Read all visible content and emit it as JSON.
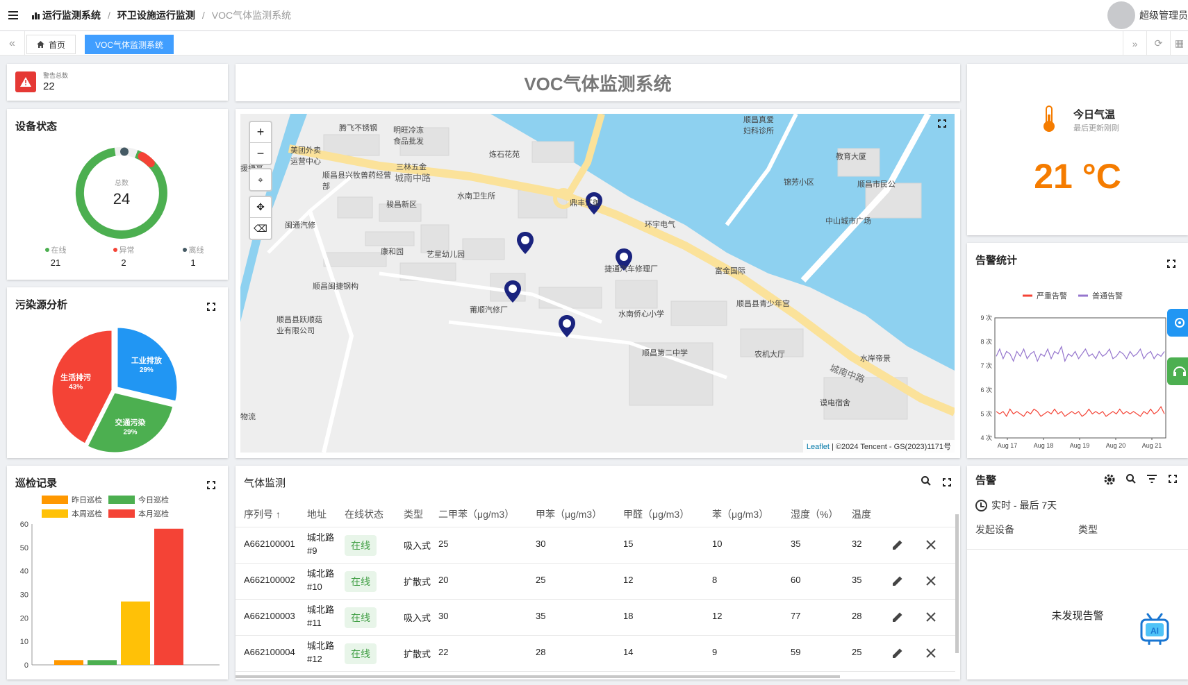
{
  "breadcrumb": {
    "level1": "运行监测系统",
    "level2": "环卫设施运行监测",
    "level3": "VOC气体监测系统"
  },
  "user": {
    "name": "超级管理员"
  },
  "tabs": [
    {
      "label": "首页"
    },
    {
      "label": "VOC气体监测系统"
    }
  ],
  "page_title": "VOC气体监测系统",
  "warning_total": {
    "label": "警告总数",
    "value": "22"
  },
  "device_status": {
    "title": "设备状态",
    "center_label": "总数",
    "total": "24",
    "legend": [
      {
        "label": "在线",
        "value": "21",
        "color": "#4caf50"
      },
      {
        "label": "异常",
        "value": "2",
        "color": "#f44336"
      },
      {
        "label": "离线",
        "value": "1",
        "color": "#455a64"
      }
    ]
  },
  "pollution": {
    "title": "污染源分析"
  },
  "inspection": {
    "title": "巡检记录"
  },
  "chart_data": [
    {
      "type": "pie",
      "title": "污染源分析",
      "slices": [
        {
          "label": "工业排放",
          "value": 29,
          "percent": "29%",
          "color": "#2196f3"
        },
        {
          "label": "交通污染",
          "value": 29,
          "percent": "29%",
          "color": "#4caf50"
        },
        {
          "label": "生活排污",
          "value": 43,
          "percent": "43%",
          "color": "#f44336"
        }
      ]
    },
    {
      "type": "bar",
      "title": "巡检记录",
      "series": [
        {
          "name": "昨日巡检",
          "value": 2,
          "color": "#ff9800"
        },
        {
          "name": "今日巡检",
          "value": 2,
          "color": "#4caf50"
        },
        {
          "name": "本周巡检",
          "value": 27,
          "color": "#ffc107"
        },
        {
          "name": "本月巡检",
          "value": 58,
          "color": "#f44336"
        }
      ],
      "ylim": [
        0,
        60
      ],
      "yticks": [
        "0",
        "10",
        "20",
        "30",
        "40",
        "50",
        "60"
      ]
    },
    {
      "type": "line",
      "title": "告警统计",
      "series": [
        {
          "name": "严重告警",
          "color": "#f44336",
          "values": [
            5.1,
            5.0,
            5.1,
            4.9,
            5.2,
            5.0,
            5.1,
            5.0,
            4.9,
            5.1,
            5.0,
            5.2,
            5.1,
            4.9,
            5.0,
            5.1,
            5.0,
            5.2,
            5.0,
            5.1,
            4.9,
            5.0,
            5.1,
            5.0,
            5.1,
            4.9,
            5.0,
            5.2,
            5.0,
            5.1,
            5.0,
            5.1,
            4.9,
            5.0,
            5.1,
            5.0,
            5.2,
            5.0,
            5.1,
            5.0,
            5.1,
            5.0,
            4.9,
            5.1,
            5.0,
            5.2,
            5.0,
            5.1,
            5.3,
            5.0
          ]
        },
        {
          "name": "普通告警",
          "color": "#9575cd",
          "values": [
            7.4,
            7.7,
            7.3,
            7.6,
            7.5,
            7.2,
            7.6,
            7.4,
            7.7,
            7.3,
            7.5,
            7.6,
            7.2,
            7.5,
            7.4,
            7.7,
            7.3,
            7.6,
            7.5,
            7.8,
            7.2,
            7.5,
            7.4,
            7.6,
            7.3,
            7.5,
            7.7,
            7.4,
            7.5,
            7.3,
            7.6,
            7.4,
            7.5,
            7.7,
            7.3,
            7.4,
            7.6,
            7.5,
            7.3,
            7.6,
            7.4,
            7.5,
            7.7,
            7.3,
            7.5,
            7.6,
            7.3,
            7.5,
            7.4,
            7.6
          ]
        }
      ],
      "ylim": [
        4,
        9
      ],
      "yticks": [
        "4 次",
        "5 次",
        "6 次",
        "7 次",
        "8 次",
        "9 次"
      ],
      "xticks": [
        "Aug 17",
        "Aug 18",
        "Aug 19",
        "Aug 20",
        "Aug 21"
      ]
    }
  ],
  "temperature": {
    "title": "今日气温",
    "subtitle": "最后更新刚刚",
    "value": "21 °C"
  },
  "alarm_stats": {
    "title": "告警统计"
  },
  "map": {
    "labels": [
      "腾飞不锈钢",
      "明旺冷冻食品批发",
      "美团外卖运营中心",
      "顺昌县兴牧兽药经营部",
      "三林五金",
      "城南中路",
      "炼石花苑",
      "顺昌真爱妇科诊所",
      "教育大厦",
      "锦芳小区",
      "顺昌市民公",
      "水南卫生所",
      "鼎丰江御",
      "骏昌新区",
      "环宇电气",
      "中山城市广场",
      "闽通汽修",
      "康和园",
      "艺星幼儿园",
      "捷通汽车修理厂",
      "富金国际",
      "顺昌闽捷钢构",
      "顺昌县青少年宫",
      "莆顺汽修厂",
      "水南侨心小学",
      "顺昌县跃顺菇业有限公司",
      "顺昌第二中学",
      "农机大厅",
      "水岸帝景",
      "城南中路",
      "谟电宿舍",
      "物流",
      "援捷亮"
    ],
    "attribution_link": "Leaflet",
    "attribution_text": " | ©2024 Tencent - GS(2023)1171号"
  },
  "gas": {
    "title": "气体监测",
    "columns": [
      "序列号 ↑",
      "地址",
      "在线状态",
      "类型",
      "二甲苯（μg/m3）",
      "甲苯（μg/m3）",
      "甲醛（μg/m3）",
      "苯（μg/m3）",
      "湿度（%）",
      "温度"
    ],
    "rows": [
      {
        "id": "A662100001",
        "addr": "城北路#9",
        "status": "在线",
        "type": "吸入式",
        "xylene": "25",
        "toluene": "30",
        "formaldehyde": "15",
        "benzene": "10",
        "humidity": "35",
        "temp": "32"
      },
      {
        "id": "A662100002",
        "addr": "城北路#10",
        "status": "在线",
        "type": "扩散式",
        "xylene": "20",
        "toluene": "25",
        "formaldehyde": "12",
        "benzene": "8",
        "humidity": "60",
        "temp": "35"
      },
      {
        "id": "A662100003",
        "addr": "城北路#11",
        "status": "在线",
        "type": "吸入式",
        "xylene": "30",
        "toluene": "35",
        "formaldehyde": "18",
        "benzene": "12",
        "humidity": "77",
        "temp": "28"
      },
      {
        "id": "A662100004",
        "addr": "城北路#12",
        "status": "在线",
        "type": "扩散式",
        "xylene": "22",
        "toluene": "28",
        "formaldehyde": "14",
        "benzene": "9",
        "humidity": "59",
        "temp": "25"
      }
    ]
  },
  "alarm": {
    "title": "告警",
    "range": "实时 - 最后 7天",
    "col_device": "发起设备",
    "col_type": "类型",
    "empty": "未发现告警"
  }
}
